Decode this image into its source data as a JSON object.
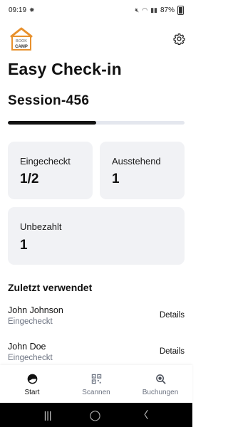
{
  "status_bar": {
    "time": "09:19",
    "battery": "87%"
  },
  "header": {
    "logo_line1": "BOOK",
    "logo_line2": "CAMP",
    "title": "Easy Check-in",
    "session": "Session-456"
  },
  "progress": {
    "fraction": 0.5
  },
  "stats": {
    "checked_in_label": "Eingecheckt",
    "checked_in_value": "1/2",
    "pending_label": "Ausstehend",
    "pending_value": "1",
    "unpaid_label": "Unbezahlt",
    "unpaid_value": "1"
  },
  "recent": {
    "title": "Zuletzt verwendet",
    "items": [
      {
        "name": "John Johnson",
        "status": "Eingecheckt",
        "action": "Details"
      },
      {
        "name": "John Doe",
        "status": "Eingecheckt",
        "action": "Details"
      }
    ]
  },
  "bottom_nav": {
    "items": [
      {
        "label": "Start",
        "icon": "chart-pie-icon",
        "active": true
      },
      {
        "label": "Scannen",
        "icon": "qr-code-icon",
        "active": false
      },
      {
        "label": "Buchungen",
        "icon": "search-icon",
        "active": false
      }
    ]
  },
  "colors": {
    "accent": "#121212",
    "card_bg": "#f1f2f5",
    "muted_text": "#6b7280",
    "logo_orange": "#e8912d"
  }
}
